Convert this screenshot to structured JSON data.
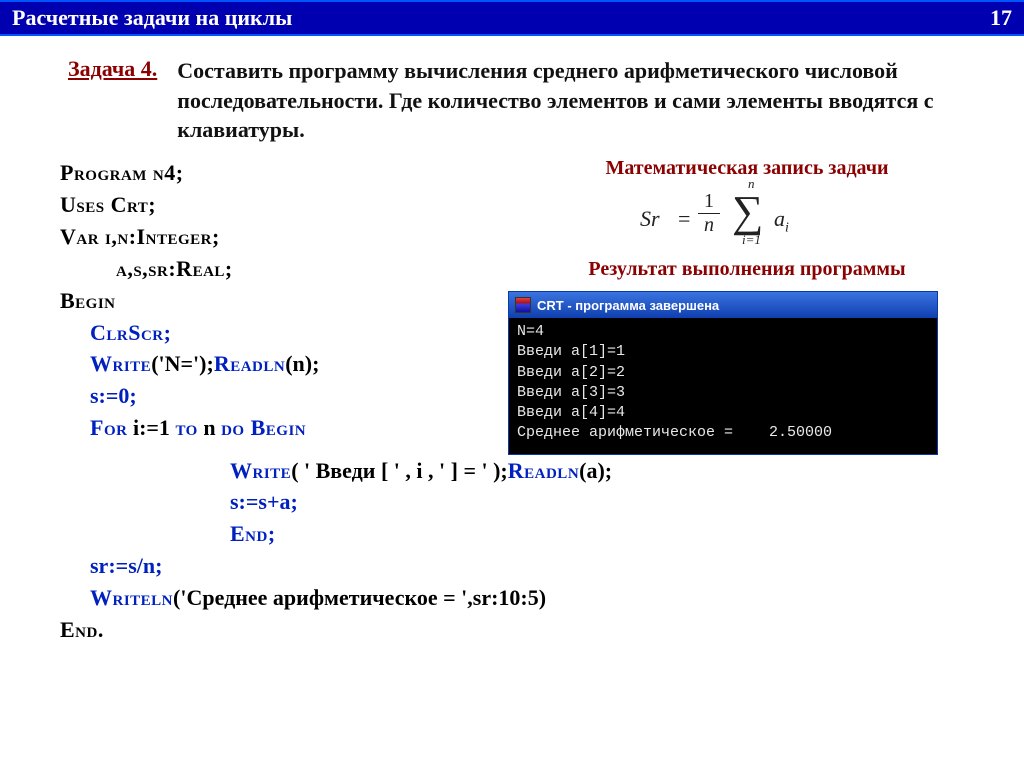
{
  "header": {
    "title": "Расчетные задачи на циклы",
    "page": "17"
  },
  "task": {
    "label": "Задача 4.",
    "desc": "Составить программу вычисления среднего арифметического числовой последовательности. Где количество элементов и сами элементы вводятся с клавиатуры."
  },
  "math": {
    "label": "Математическая запись задачи",
    "sr": "Sr",
    "eq": "=",
    "num": "1",
    "den": "n",
    "sigma": "∑",
    "sup": "n",
    "sub": "i=1",
    "a": "a",
    "ai_sub": "i"
  },
  "result_label": "Результат выполнения программы",
  "console": {
    "title": "CRT - программа завершена",
    "lines": "N=4\nВведи a[1]=1\nВведи a[2]=2\nВведи a[3]=3\nВведи a[4]=4\nСреднее арифметическое =    2.50000"
  },
  "code": {
    "l01": "Program n4;",
    "l02": "Uses Crt;",
    "l03": "Var i,n:Integer;",
    "l04": "a,s,sr:Real;",
    "l05": "Begin",
    "l06": "ClrScr;",
    "l07a": "Write",
    "l07b": "('N=');",
    "l07c": "Readln",
    "l07d": "(n);",
    "l08": "s:=0;",
    "l09a": "For",
    "l09b": " i:=1 ",
    "l09c": "to",
    "l09d": " n ",
    "l09e": "do Begin",
    "l10a": "Write",
    "l10b": "( ' Введи [ ' , i , ' ] = ' );",
    "l10c": "Readln",
    "l10d": "(a);",
    "l11": "s:=s+a;",
    "l12": "End;",
    "l13": "sr:=s/n;",
    "l14a": "Writeln",
    "l14b": "('Среднее арифметическое = ',sr:10:5)",
    "l15": "End."
  }
}
